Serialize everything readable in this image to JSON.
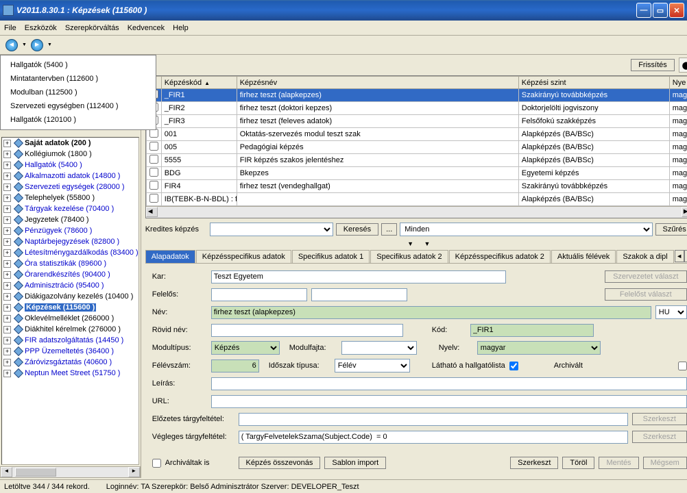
{
  "window": {
    "title": "V2011.8.30.1 : Képzések (115600  )"
  },
  "menu": {
    "file": "File",
    "tools": "Eszközök",
    "role": "Szerepkörváltás",
    "fav": "Kedvencek",
    "help": "Help"
  },
  "dropdown": {
    "items": [
      "Hallgatók (5400  )",
      "Mintatantervben (112600  )",
      "Modulban (112500  )",
      "Szervezeti egységben (112400  )",
      "Hallgatók (120100  )"
    ]
  },
  "tree": [
    {
      "label": "Saját adatok (200  )",
      "bold": true,
      "black": true
    },
    {
      "label": "Kollégiumok (1800  )",
      "black": true
    },
    {
      "label": "Hallgatók (5400  )"
    },
    {
      "label": "Alkalmazotti adatok (14800  )"
    },
    {
      "label": "Szervezeti egységek (28000  )"
    },
    {
      "label": "Telephelyek (55800  )",
      "black": true
    },
    {
      "label": "Tárgyak kezelése (70400  )"
    },
    {
      "label": "Jegyzetek (78400  )",
      "black": true
    },
    {
      "label": "Pénzügyek (78600  )"
    },
    {
      "label": "Naptárbejegyzések (82800  )"
    },
    {
      "label": "Létesítménygazdálkodás (83400  )"
    },
    {
      "label": "Óra statisztikák (89600  )"
    },
    {
      "label": "Órarendkészítés (90400  )"
    },
    {
      "label": "Adminisztráció (95400  )"
    },
    {
      "label": "Diákigazolvány kezelés (10400  )",
      "black": true
    },
    {
      "label": "Képzések (115600  )",
      "bold": true,
      "sel": true
    },
    {
      "label": "Oklevélmelléklet (266000  )",
      "black": true
    },
    {
      "label": "Diákhitel kérelmek (276000  )",
      "black": true
    },
    {
      "label": "FIR adatszolgáltatás (14450  )"
    },
    {
      "label": "PPP Üzemeltetés (36400  )"
    },
    {
      "label": "Záróvizsgáztatás (40600  )"
    },
    {
      "label": "Neptun Meet Street (51750  )"
    }
  ],
  "refresh": "Frissítés",
  "grid": {
    "cols": {
      "code": "Képzéskód",
      "name": "Képzésnév",
      "level": "Képzési szint",
      "lang": "Nye"
    },
    "rows": [
      {
        "code": "_FIR1",
        "name": "firhez teszt (alapkepzes)",
        "level": "Szakirányú továbbképzés",
        "lang": "mag",
        "sel": true
      },
      {
        "code": "_FIR2",
        "name": "firhez teszt (doktori kepzes)",
        "level": "Doktorjelölti jogviszony",
        "lang": "mag"
      },
      {
        "code": "_FIR3",
        "name": "firhez teszt (feleves adatok)",
        "level": "Felsőfokú szakképzés",
        "lang": "mag"
      },
      {
        "code": "001",
        "name": "Oktatás-szervezés modul teszt szak",
        "level": "Alapképzés (BA/BSc)",
        "lang": "mag"
      },
      {
        "code": "005",
        "name": "Pedagógiai képzés",
        "level": "Alapképzés (BA/BSc)",
        "lang": "mag"
      },
      {
        "code": "5555",
        "name": "FIR képzés szakos jelentéshez",
        "level": "Alapképzés (BA/BSc)",
        "lang": "mag"
      },
      {
        "code": "BDG",
        "name": "Bkepzes",
        "level": "Egyetemi képzés",
        "lang": "mag"
      },
      {
        "code": "FIR4",
        "name": "firhez teszt (vendeghallgat)",
        "level": "Szakirányú továbbképzés",
        "lang": "mag"
      },
      {
        "code": "IB(TEBK-B-N-BDL) : fel ne változtasd meg egyik mezo erteket sem, koszil",
        "name": "",
        "level": "Alapképzés (BA/BSc)",
        "lang": "mag"
      }
    ]
  },
  "search": {
    "label": "Kredites képzés",
    "btn_search": "Keresés",
    "btn_dots": "...",
    "combo2_value": "Minden",
    "btn_filter": "Szűrés"
  },
  "tabs": {
    "t0": "Alapadatok",
    "t1": "Képzésspecifikus adatok",
    "t2": "Specifikus adatok 1",
    "t3": "Specifikus adatok 2",
    "t4": "Képzésspecifikus adatok 2",
    "t5": "Aktuális félévek",
    "t6": "Szakok a dipl"
  },
  "form": {
    "kar_l": "Kar:",
    "kar_v": "Teszt Egyetem",
    "felelos_l": "Felelős:",
    "btn_szerv": "Szervezetet választ",
    "btn_fel": "Felelőst választ",
    "nev_l": "Név:",
    "nev_v": "firhez teszt (alapkepzes)",
    "nev_lang": "HU",
    "rovid_l": "Rövid név:",
    "kod_l": "Kód:",
    "kod_v": "_FIR1",
    "modtip_l": "Modultípus:",
    "modtip_v": "Képzés",
    "modfaj_l": "Modulfajta:",
    "nyelv_l": "Nyelv:",
    "nyelv_v": "magyar",
    "felev_l": "Félévszám:",
    "felev_v": "6",
    "idoszak_l": "Időszak típusa:",
    "idoszak_v": "Félév",
    "lathato_l": "Látható a hallgatólista",
    "archivalt_l": "Archivált",
    "leiras_l": "Leírás:",
    "url_l": "URL:",
    "elozetes_l": "Előzetes tárgyfeltétel:",
    "vegleges_l": "Végleges tárgyfeltétel:",
    "vegleges_v": "( TargyFelvetelekSzama(Subject.Code)  = 0",
    "btn_szerk": "Szerkeszt"
  },
  "bottom": {
    "archivaltak": "Archiváltak is",
    "osszevon": "Képzés összevonás",
    "sablon": "Sablon import",
    "szerk": "Szerkeszt",
    "torol": "Töröl",
    "mentes": "Mentés",
    "megsem": "Mégsem"
  },
  "status": {
    "left": "Letöltve 344 / 344 rekord.",
    "mid": "Loginnév: TA   Szerepkör: Belső Adminisztrátor   Szerver: DEVELOPER_Teszt"
  }
}
